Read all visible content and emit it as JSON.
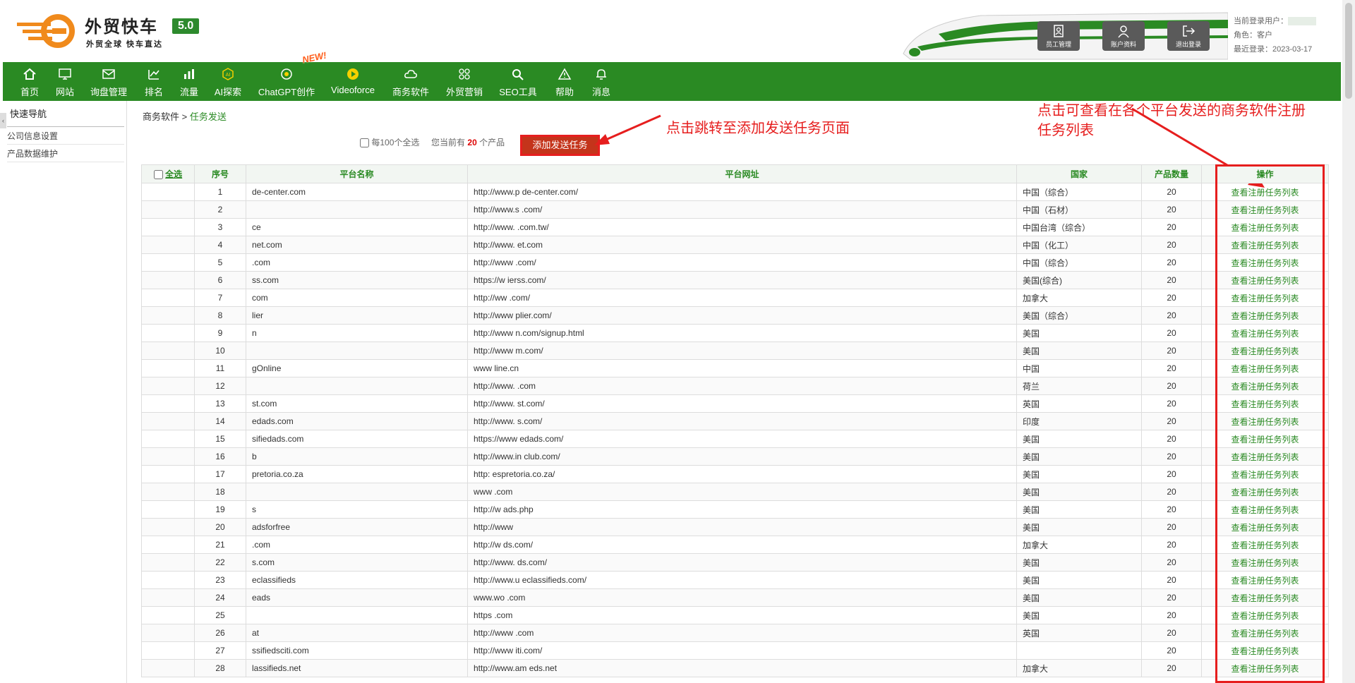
{
  "logo": {
    "title": "外贸快车",
    "version": "5.0",
    "subtitle": "外贸全球 快车直达"
  },
  "header_buttons": [
    {
      "label": "员工管理",
      "icon": "staff-icon"
    },
    {
      "label": "账户资料",
      "icon": "account-icon"
    },
    {
      "label": "退出登录",
      "icon": "logout-icon"
    }
  ],
  "user": {
    "current_label": "当前登录用户：",
    "role": "角色：客户",
    "last_login": "最近登录：2023-03-17"
  },
  "nav": [
    {
      "label": "首页",
      "icon": "home-icon"
    },
    {
      "label": "网站",
      "icon": "monitor-icon"
    },
    {
      "label": "询盘管理",
      "icon": "mail-icon"
    },
    {
      "label": "排名",
      "icon": "ranking-icon"
    },
    {
      "label": "流量",
      "icon": "bars-icon"
    },
    {
      "label": "AI探索",
      "icon": "ai-icon"
    },
    {
      "label": "ChatGPT创作",
      "icon": "chatgpt-icon"
    },
    {
      "label": "Videoforce",
      "icon": "video-icon"
    },
    {
      "label": "商务软件",
      "icon": "cloud-icon"
    },
    {
      "label": "外贸营销",
      "icon": "grid-icon"
    },
    {
      "label": "SEO工具",
      "icon": "search-icon"
    },
    {
      "label": "帮助",
      "icon": "warning-icon"
    },
    {
      "label": "消息",
      "icon": "bell-icon"
    }
  ],
  "new_badge": "NEW!",
  "sidebar": {
    "title": "快速导航",
    "items": [
      "公司信息设置",
      "产品数据维护"
    ]
  },
  "breadcrumb": {
    "parent": "商务软件",
    "sep": " > ",
    "current": "任务发送"
  },
  "toolbar": {
    "select100": "每100个全选",
    "prefix": "您当前有",
    "count": "20",
    "suffix": "个产品",
    "add_button": "添加发送任务"
  },
  "annotations": {
    "add": "点击跳转至添加发送任务页面",
    "list": "点击可查看在各个平台发送的商务软件注册任务列表"
  },
  "table": {
    "headers": [
      "全选",
      "序号",
      "平台名称",
      "平台网址",
      "国家",
      "产品数量",
      "操作"
    ],
    "action_label": "查看注册任务列表",
    "rows": [
      {
        "no": "1",
        "name": "de-center.com",
        "url": "http://www.p de-center.com/",
        "country": "中国（综合）",
        "qty": "20"
      },
      {
        "no": "2",
        "name": "",
        "url": "http://www.s .com/",
        "country": "中国（石材）",
        "qty": "20"
      },
      {
        "no": "3",
        "name": "ce",
        "url": "http://www. .com.tw/",
        "country": "中国台湾（综合）",
        "qty": "20"
      },
      {
        "no": "4",
        "name": "net.com",
        "url": "http://www. et.com",
        "country": "中国（化工）",
        "qty": "20"
      },
      {
        "no": "5",
        "name": ".com",
        "url": "http://www .com/",
        "country": "中国（综合）",
        "qty": "20"
      },
      {
        "no": "6",
        "name": "ss.com",
        "url": "https://w ierss.com/",
        "country": "美国(综合)",
        "qty": "20"
      },
      {
        "no": "7",
        "name": "com",
        "url": "http://ww .com/",
        "country": "加拿大",
        "qty": "20"
      },
      {
        "no": "8",
        "name": "lier",
        "url": "http://www plier.com/",
        "country": "美国（综合）",
        "qty": "20"
      },
      {
        "no": "9",
        "name": "n",
        "url": "http://www n.com/signup.html",
        "country": "美国",
        "qty": "20"
      },
      {
        "no": "10",
        "name": "",
        "url": "http://www m.com/",
        "country": "美国",
        "qty": "20"
      },
      {
        "no": "11",
        "name": "gOnline",
        "url": "www line.cn",
        "country": "中国",
        "qty": "20"
      },
      {
        "no": "12",
        "name": "",
        "url": "http://www. .com",
        "country": "荷兰",
        "qty": "20"
      },
      {
        "no": "13",
        "name": "st.com",
        "url": "http://www. st.com/",
        "country": "英国",
        "qty": "20"
      },
      {
        "no": "14",
        "name": "edads.com",
        "url": "http://www. s.com/",
        "country": "印度",
        "qty": "20"
      },
      {
        "no": "15",
        "name": "sifiedads.com",
        "url": "https://www edads.com/",
        "country": "美国",
        "qty": "20"
      },
      {
        "no": "16",
        "name": "b",
        "url": "http://www.in club.com/",
        "country": "美国",
        "qty": "20"
      },
      {
        "no": "17",
        "name": "pretoria.co.za",
        "url": "http: espretoria.co.za/",
        "country": "美国",
        "qty": "20"
      },
      {
        "no": "18",
        "name": "",
        "url": "www .com",
        "country": "美国",
        "qty": "20"
      },
      {
        "no": "19",
        "name": "s",
        "url": "http://w ads.php",
        "country": "美国",
        "qty": "20"
      },
      {
        "no": "20",
        "name": "adsforfree",
        "url": "http://www",
        "country": "美国",
        "qty": "20"
      },
      {
        "no": "21",
        "name": ".com",
        "url": "http://w ds.com/",
        "country": "加拿大",
        "qty": "20"
      },
      {
        "no": "22",
        "name": "s.com",
        "url": "http://www. ds.com/",
        "country": "美国",
        "qty": "20"
      },
      {
        "no": "23",
        "name": "eclassifieds",
        "url": "http://www.u eclassifieds.com/",
        "country": "美国",
        "qty": "20"
      },
      {
        "no": "24",
        "name": "eads",
        "url": "www.wo .com",
        "country": "美国",
        "qty": "20"
      },
      {
        "no": "25",
        "name": "",
        "url": "https .com",
        "country": "美国",
        "qty": "20"
      },
      {
        "no": "26",
        "name": "at",
        "url": "http://www .com",
        "country": "英国",
        "qty": "20"
      },
      {
        "no": "27",
        "name": "ssifiedsciti.com",
        "url": "http://www iti.com/",
        "country": "",
        "qty": "20"
      },
      {
        "no": "28",
        "name": "lassifieds.net",
        "url": "http://www.am eds.net",
        "country": "加拿大",
        "qty": "20"
      }
    ]
  },
  "colors": {
    "brand_green": "#2a8a23",
    "annotation_red": "#e61e1e",
    "version_badge": "#2d8a2d"
  }
}
